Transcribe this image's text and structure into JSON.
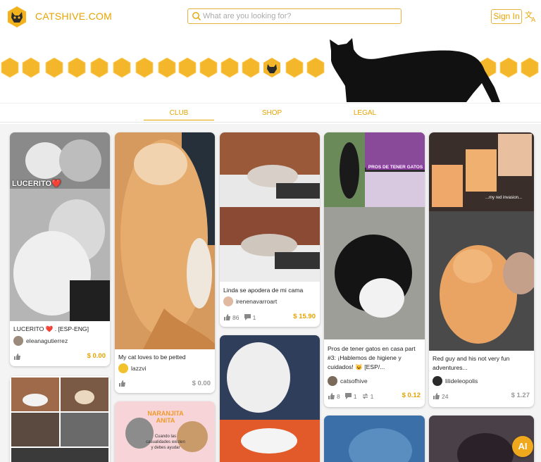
{
  "brand": {
    "name": "CATSHIVE.COM"
  },
  "search": {
    "placeholder": "What are you looking for?"
  },
  "header": {
    "signin_label": "Sign In"
  },
  "nav": {
    "items": [
      "CLUB",
      "SHOP",
      "LEGAL"
    ],
    "active": "CLUB"
  },
  "colors": {
    "accent": "#e6a400",
    "feed_bg": "#f4f4f4"
  },
  "posts": [
    {
      "title": "LUCERITO ❤️ . [ESP-ENG]",
      "image_caption": "LUCERITO❤️",
      "author": "eleanagutierrez",
      "price": "$ 0.00"
    },
    {
      "title": "My cat loves to be petted",
      "author": "lazzvi",
      "price": "$ 0.00"
    },
    {
      "title": "Linda se apodera de mi cama",
      "author": "irenenavarroart",
      "votes": "86",
      "comments": "1",
      "price": "$ 15.90"
    },
    {
      "title": "Pros de tener gatos en casa part #3: ¡Hablemos de higiene y cuidados! 😺 [ESP/...",
      "image_caption": "PROS DE TENER GATOS",
      "author": "catsofhive",
      "votes": "8",
      "comments": "1",
      "reblogs": "1",
      "price": "$ 0.12"
    },
    {
      "title": "Red guy and his not very fun adventures...",
      "image_caption": "...my red invasion...",
      "author": "lilideleopolis",
      "votes": "24",
      "price": "$ 1.27"
    },
    {
      "title": "",
      "image_caption": "NARANJITA ANITA",
      "image_subcaption": "Cuando las casualidades existen y debes ayudar"
    }
  ],
  "ai_button": {
    "label": "AI"
  }
}
